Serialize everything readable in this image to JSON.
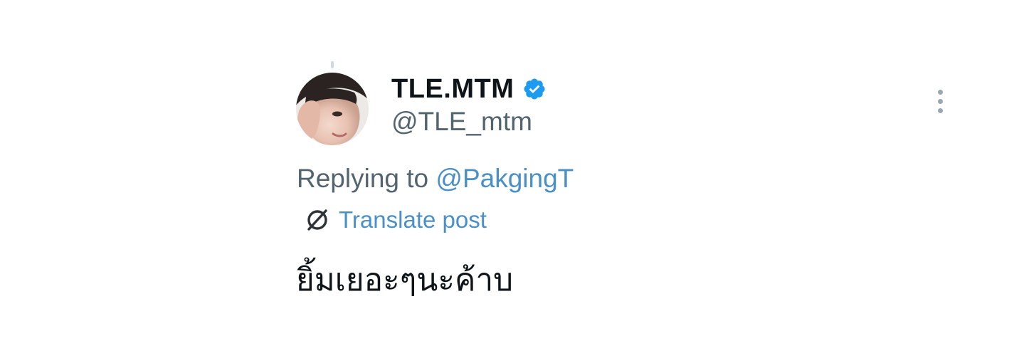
{
  "author": {
    "display_name": "TLE.MTM",
    "handle": "@TLE_mtm",
    "verified": true,
    "avatar_icon": "profile-photo",
    "verified_icon": "verified-badge-icon",
    "verified_color": "#1d9bf0"
  },
  "menu": {
    "more_icon": "more-vertical-icon"
  },
  "reply": {
    "prefix": "Replying to",
    "mention": "@PakgingT"
  },
  "translate": {
    "icon": "globe-slash-icon",
    "label": "Translate post"
  },
  "post": {
    "text": "ยิ้มเยอะๆนะค้าบ"
  },
  "colors": {
    "text_primary": "#0f1419",
    "text_secondary": "#536471",
    "link": "#4a90c8",
    "icon_muted": "#9aa7b1"
  }
}
